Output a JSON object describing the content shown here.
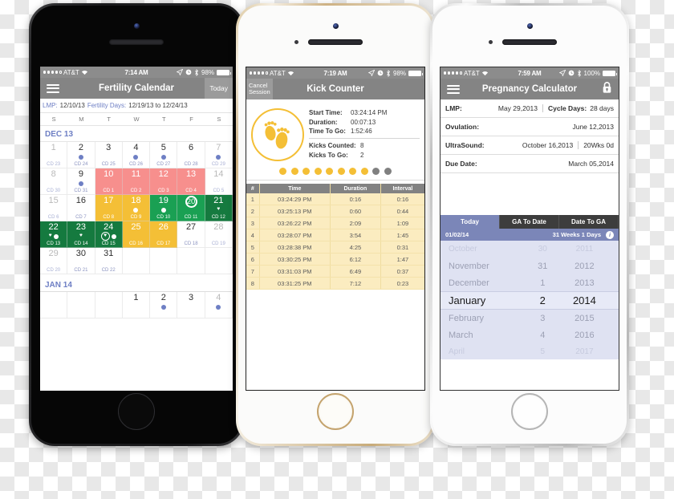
{
  "phone1": {
    "status": {
      "carrier": "AT&T",
      "time": "7:14 AM",
      "battery": "98%"
    },
    "nav": {
      "title": "Fertility Calendar",
      "today_label": "Today",
      "menu_icon": "hamburger-icon"
    },
    "info": {
      "lmp_label": "LMP:",
      "lmp_value": "12/10/13",
      "fertility_label": "Fertility Days:",
      "fertility_value": "12/19/13 to 12/24/13"
    },
    "dow": [
      "S",
      "M",
      "T",
      "W",
      "T",
      "F",
      "S"
    ],
    "month_label": "DEC 13",
    "next_month_label": "JAN 14",
    "weeks": [
      [
        {
          "num": "1",
          "cd": "CD 23",
          "style": "c-dim",
          "marks": []
        },
        {
          "num": "2",
          "cd": "CD 24",
          "style": "",
          "marks": [
            "dot"
          ]
        },
        {
          "num": "3",
          "cd": "CD 25",
          "style": "",
          "marks": []
        },
        {
          "num": "4",
          "cd": "CD 26",
          "style": "",
          "marks": [
            "dot"
          ]
        },
        {
          "num": "5",
          "cd": "CD 27",
          "style": "",
          "marks": [
            "dot"
          ]
        },
        {
          "num": "6",
          "cd": "CD 28",
          "style": "",
          "marks": []
        },
        {
          "num": "7",
          "cd": "CD 29",
          "style": "c-dim",
          "marks": [
            "dot"
          ]
        }
      ],
      [
        {
          "num": "8",
          "cd": "CD 30",
          "style": "c-dim",
          "marks": []
        },
        {
          "num": "9",
          "cd": "CD 31",
          "style": "",
          "marks": [
            "dot"
          ]
        },
        {
          "num": "10",
          "cd": "CD 1",
          "style": "c-pink",
          "marks": []
        },
        {
          "num": "11",
          "cd": "CD 2",
          "style": "c-pink",
          "marks": []
        },
        {
          "num": "12",
          "cd": "CD 3",
          "style": "c-pink",
          "marks": []
        },
        {
          "num": "13",
          "cd": "CD 4",
          "style": "c-pink",
          "marks": []
        },
        {
          "num": "14",
          "cd": "CD 5",
          "style": "c-dim",
          "marks": []
        }
      ],
      [
        {
          "num": "15",
          "cd": "CD 6",
          "style": "c-dim",
          "marks": []
        },
        {
          "num": "16",
          "cd": "CD 7",
          "style": "",
          "marks": []
        },
        {
          "num": "17",
          "cd": "CD 8",
          "style": "c-yellow",
          "marks": []
        },
        {
          "num": "18",
          "cd": "CD 9",
          "style": "c-yellow",
          "marks": [
            "wdot"
          ]
        },
        {
          "num": "19",
          "cd": "CD 10",
          "style": "c-green",
          "marks": [
            "wdot"
          ]
        },
        {
          "num": "20",
          "cd": "CD 11",
          "style": "c-green",
          "marks": [],
          "selected": true
        },
        {
          "num": "21",
          "cd": "CD 12",
          "style": "c-dgreen",
          "marks": [
            "heart"
          ]
        }
      ],
      [
        {
          "num": "22",
          "cd": "CD 13",
          "style": "c-dgreen",
          "marks": [
            "heart",
            "wdot"
          ]
        },
        {
          "num": "23",
          "cd": "CD 14",
          "style": "c-dgreen",
          "marks": [
            "heart"
          ]
        },
        {
          "num": "24",
          "cd": "CD 15",
          "style": "c-dgreen",
          "marks": [
            "ringheart",
            "wdot"
          ]
        },
        {
          "num": "25",
          "cd": "CD 16",
          "style": "c-yellow",
          "marks": []
        },
        {
          "num": "26",
          "cd": "CD 17",
          "style": "c-yellow",
          "marks": []
        },
        {
          "num": "27",
          "cd": "CD 18",
          "style": "c-white",
          "marks": []
        },
        {
          "num": "28",
          "cd": "CD 19",
          "style": "c-white c-dim",
          "marks": []
        }
      ],
      [
        {
          "num": "29",
          "cd": "CD 20",
          "style": "c-dim",
          "marks": []
        },
        {
          "num": "30",
          "cd": "CD 21",
          "style": "",
          "marks": []
        },
        {
          "num": "31",
          "cd": "CD 22",
          "style": "",
          "marks": []
        },
        {
          "num": "",
          "cd": "",
          "style": "c-white",
          "marks": []
        },
        {
          "num": "",
          "cd": "",
          "style": "c-white",
          "marks": []
        },
        {
          "num": "",
          "cd": "",
          "style": "c-white",
          "marks": []
        },
        {
          "num": "",
          "cd": "",
          "style": "c-white",
          "marks": []
        }
      ]
    ],
    "jan_week": [
      {
        "num": "",
        "cd": "",
        "style": "c-white",
        "marks": []
      },
      {
        "num": "",
        "cd": "",
        "style": "c-white",
        "marks": []
      },
      {
        "num": "",
        "cd": "",
        "style": "c-white",
        "marks": []
      },
      {
        "num": "1",
        "cd": "",
        "style": "",
        "marks": []
      },
      {
        "num": "2",
        "cd": "",
        "style": "",
        "marks": [
          "dot"
        ]
      },
      {
        "num": "3",
        "cd": "",
        "style": "",
        "marks": []
      },
      {
        "num": "4",
        "cd": "",
        "style": "c-dim",
        "marks": [
          "dot"
        ]
      }
    ]
  },
  "phone2": {
    "status": {
      "carrier": "AT&T",
      "time": "7:19 AM",
      "battery": "98%"
    },
    "nav": {
      "title": "Kick Counter",
      "cancel_line1": "Cancel",
      "cancel_line2": "Session"
    },
    "icon_name": "baby-footprints-icon",
    "stats": [
      {
        "key": "Start Time:",
        "value": "03:24:14 PM"
      },
      {
        "key": "Duration:",
        "value": "00:07:13"
      },
      {
        "key": "Time To Go:",
        "value": "1:52:46"
      }
    ],
    "counts": [
      {
        "key": "Kicks Counted:",
        "value": "8"
      },
      {
        "key": "Kicks To Go:",
        "value": "2"
      }
    ],
    "dots_filled": 8,
    "dots_empty": 2,
    "table": {
      "headers": [
        "#",
        "Time",
        "Duration",
        "Interval"
      ],
      "rows": [
        [
          "1",
          "03:24:29 PM",
          "0:16",
          "0:16"
        ],
        [
          "2",
          "03:25:13 PM",
          "0:60",
          "0:44"
        ],
        [
          "3",
          "03:26:22 PM",
          "2:09",
          "1:09"
        ],
        [
          "4",
          "03:28:07 PM",
          "3:54",
          "1:45"
        ],
        [
          "5",
          "03:28:38 PM",
          "4:25",
          "0:31"
        ],
        [
          "6",
          "03:30:25 PM",
          "6:12",
          "1:47"
        ],
        [
          "7",
          "03:31:03 PM",
          "6:49",
          "0:37"
        ],
        [
          "8",
          "03:31:25 PM",
          "7:12",
          "0:23"
        ]
      ]
    }
  },
  "phone3": {
    "status": {
      "carrier": "AT&T",
      "time": "7:59 AM",
      "battery": "100%"
    },
    "nav": {
      "title": "Pregnancy Calculator",
      "menu_icon": "hamburger-icon",
      "lock_icon": "lock-icon"
    },
    "fields": [
      {
        "key": "LMP:",
        "value": "May 29,2013",
        "key2": "Cycle Days:",
        "value2": "28 days"
      },
      {
        "key": "Ovulation:",
        "value": "June 12,2013"
      },
      {
        "key": "UltraSound:",
        "value": "October 16,2013",
        "value2": "20Wks 0d"
      },
      {
        "key": "Due Date:",
        "value": "March 05,2014"
      }
    ],
    "tabs": [
      {
        "label": "Today",
        "active": true
      },
      {
        "label": "GA To Date",
        "active": false
      },
      {
        "label": "Date To GA",
        "active": false
      }
    ],
    "subbar": {
      "date": "01/02/14",
      "gestation": "31 Weeks 1 Days",
      "info_icon": "info-icon"
    },
    "picker": {
      "rows": [
        {
          "month": "October",
          "day": "30",
          "year": "2011",
          "state": "faint"
        },
        {
          "month": "November",
          "day": "31",
          "year": "2012",
          "state": ""
        },
        {
          "month": "December",
          "day": "1",
          "year": "2013",
          "state": ""
        },
        {
          "month": "January",
          "day": "2",
          "year": "2014",
          "state": "sel"
        },
        {
          "month": "February",
          "day": "3",
          "year": "2015",
          "state": ""
        },
        {
          "month": "March",
          "day": "4",
          "year": "2016",
          "state": ""
        },
        {
          "month": "April",
          "day": "5",
          "year": "2017",
          "state": "faint"
        }
      ]
    }
  },
  "colors": {
    "accent_blue": "#6e7fc4",
    "period_pink": "#f78f8d",
    "fertile_yellow": "#f4bf36",
    "fertile_green": "#1aa053",
    "peak_green": "#157a3f",
    "kick_yellow": "#f4bf36",
    "picker_purple": "#7b86b8",
    "navbar_gray": "#848484"
  }
}
